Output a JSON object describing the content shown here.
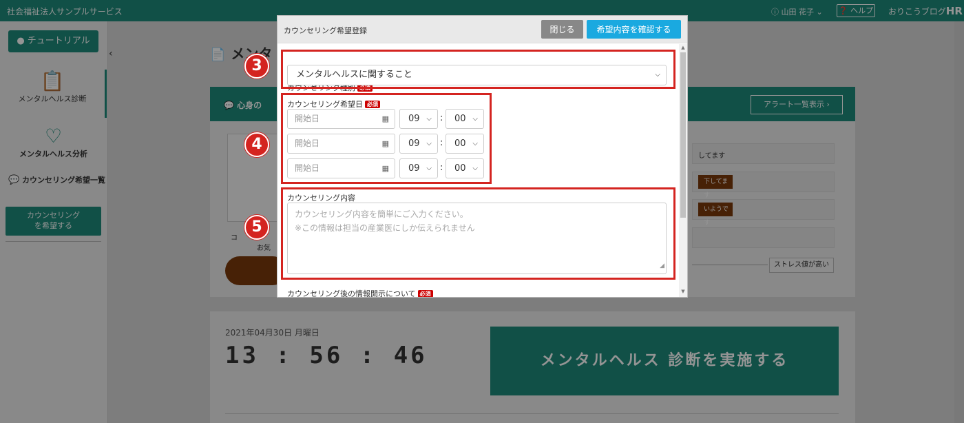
{
  "header": {
    "org_name": "社会福祉法人サンプルサービス",
    "user_name": "山田 花子",
    "help_label": "ヘルプ",
    "brand_prefix": "おりこうブログ",
    "brand_logo": "HR"
  },
  "sidebar": {
    "tutorial_label": "チュートリアル",
    "items": [
      {
        "label": "メンタルヘルス診断",
        "icon": "clipboard-icon"
      },
      {
        "label": "メンタルヘルス分析",
        "icon": "heart-icon"
      },
      {
        "label": "カウンセリング希望一覧",
        "icon": "chat-icon"
      }
    ],
    "cta_label_1": "カウンセリング",
    "cta_label_2": "を希望する"
  },
  "main": {
    "title": "メンタ",
    "panel_title": "心身の",
    "alert_button": "アラート一覧表示",
    "label_partial_1": "コ",
    "label_partial_2": "お気",
    "status_rows": [
      "してます",
      "下してます",
      "いようです"
    ],
    "stress_tag": "ストレス値が高い",
    "date_label": "2021年04月30日 月曜日",
    "clock": "13 : 56 : 46",
    "diagnose_button": "メンタルヘルス 診断を実施する"
  },
  "modal": {
    "title": "カウンセリング希望登録",
    "close_button": "閉じる",
    "confirm_button": "希望内容を確認する",
    "required_badge": "必須",
    "type_label": "カウンセリング種別",
    "type_value": "メンタルヘルスに関すること",
    "date_label": "カウンセリング希望日",
    "date_placeholder": "開始日",
    "date_rows": [
      {
        "hour": "09",
        "minute": "00"
      },
      {
        "hour": "09",
        "minute": "00"
      },
      {
        "hour": "09",
        "minute": "00"
      }
    ],
    "content_label": "カウンセリング内容",
    "content_placeholder_1": "カウンセリング内容を簡単にご入力ください。",
    "content_placeholder_2": "※この情報は担当の産業医にしか伝えられません",
    "disclosure_label": "カウンセリング後の情報開示について"
  },
  "annotations": {
    "markers": [
      "3",
      "4",
      "5"
    ],
    "color": "#d42420"
  },
  "colors": {
    "brand": "#1e8a7a",
    "confirm": "#1aa9e0",
    "required": "#cc0000"
  }
}
